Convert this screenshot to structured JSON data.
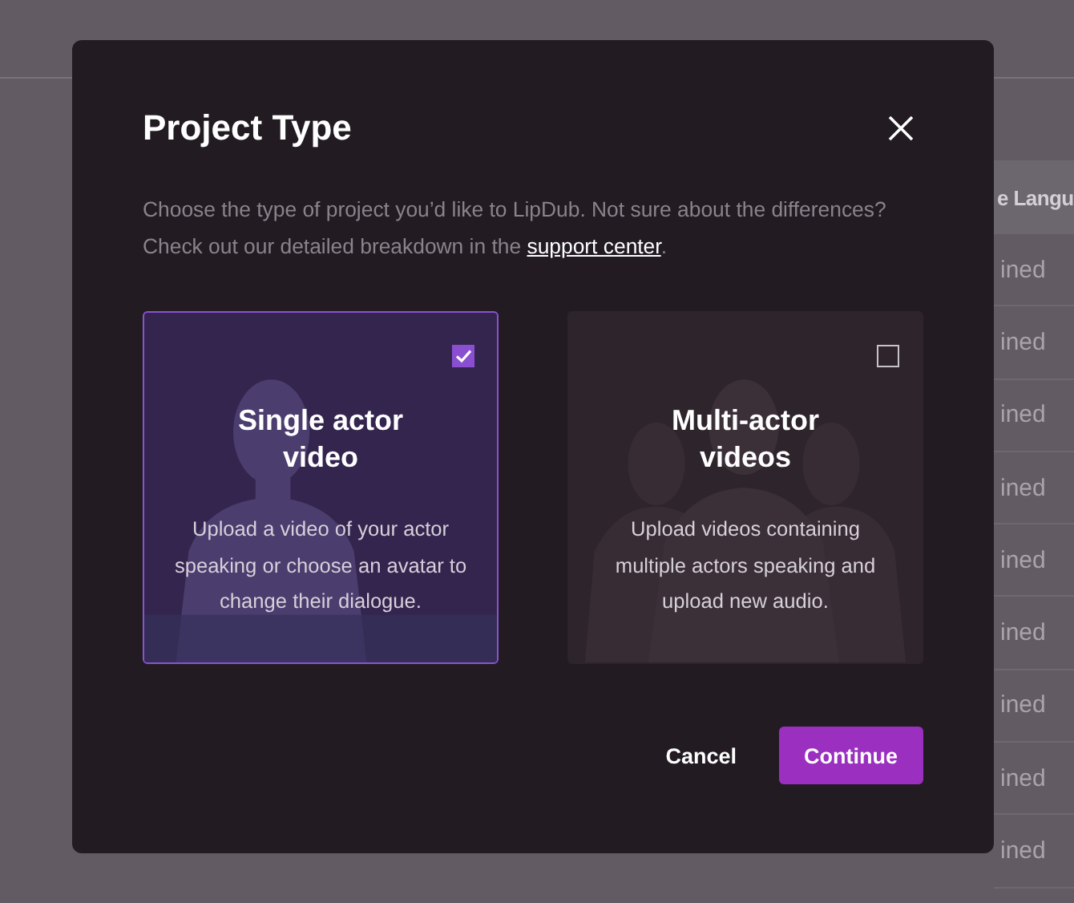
{
  "background_table": {
    "header": "e Langu",
    "rows": [
      {
        "cell": "ined"
      },
      {
        "cell": "ined"
      },
      {
        "cell": "ined"
      },
      {
        "cell": "ined"
      },
      {
        "cell": "ined"
      },
      {
        "cell": "ined"
      },
      {
        "cell": "ined"
      },
      {
        "cell": "ined"
      },
      {
        "cell": "ined"
      }
    ]
  },
  "dialog": {
    "title": "Project Type",
    "description": "Choose the type of project you’d like to LipDub. Not sure about the differences? Check out our detailed breakdown in the ",
    "link": "support center",
    "description_end": ".",
    "options": [
      {
        "kind": "single",
        "title": "Single actor video",
        "description": "Upload a video of your actor speaking or choose an avatar to change their dialogue.",
        "selected": true
      },
      {
        "kind": "multi",
        "title": "Multi-actor videos",
        "description": "Upload videos containing multiple actors speaking and upload new audio.",
        "selected": false
      }
    ],
    "buttons": [
      {
        "kind": "secondary",
        "label": "Cancel"
      },
      {
        "kind": "primary",
        "label": "Continue"
      }
    ]
  }
}
